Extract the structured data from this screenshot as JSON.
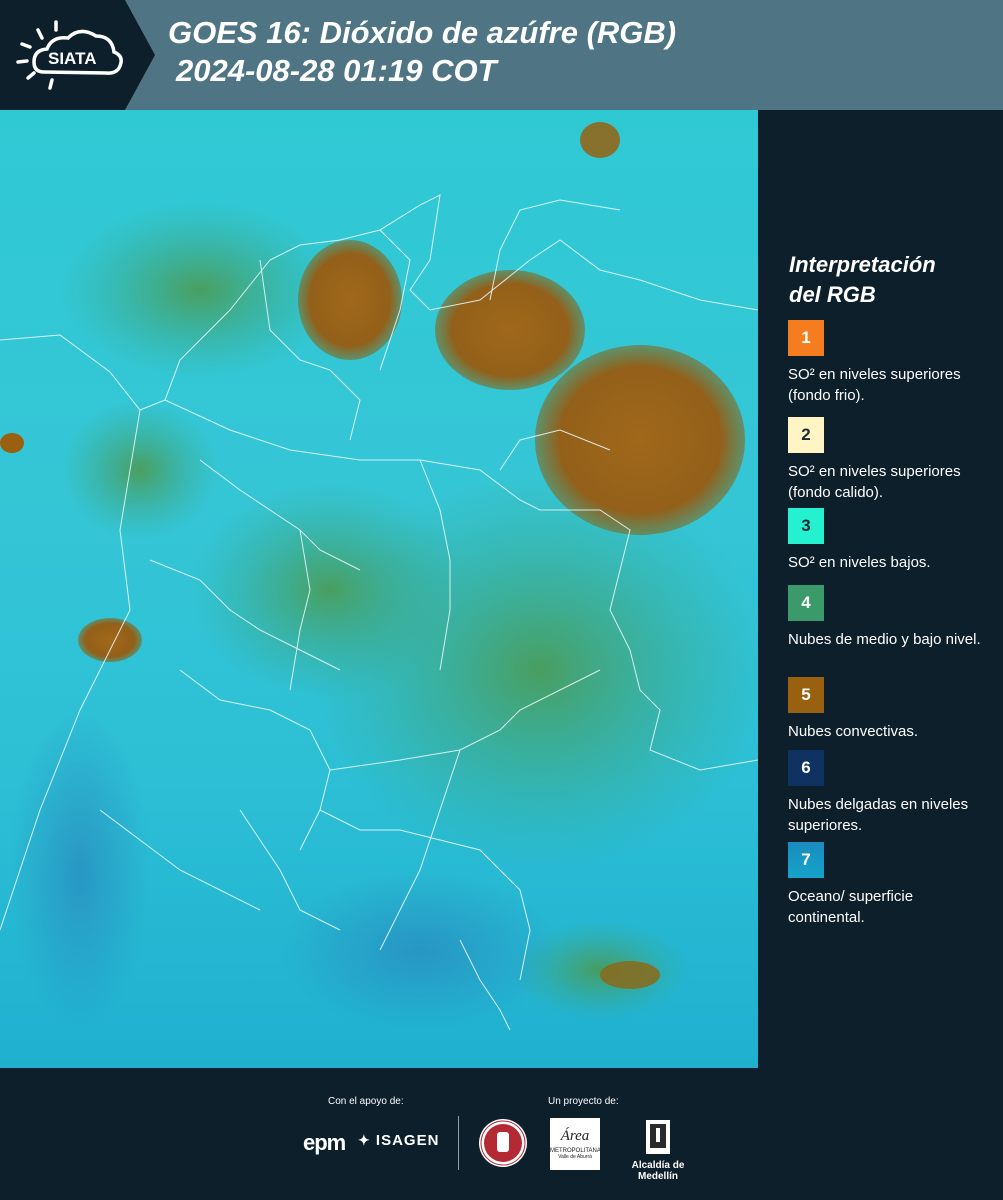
{
  "header": {
    "logo_text": "SIATA",
    "title_line1": "GOES 16: Dióxido de azúfre (RGB)",
    "title_line2": "2024-08-28 01:19 COT"
  },
  "legend": {
    "title_line1": "Interpretación",
    "title_line2": "del RGB",
    "items": [
      {
        "num": "1",
        "color": "#f57c1f",
        "label": "SO² en niveles superiores (fondo frio)."
      },
      {
        "num": "2",
        "color": "#fff5c4",
        "label": "SO² en niveles superiores (fondo calido)."
      },
      {
        "num": "3",
        "color": "#25f0cf",
        "label": "SO² en niveles bajos."
      },
      {
        "num": "4",
        "color": "#3a9a6a",
        "label": "Nubes de medio y bajo nivel."
      },
      {
        "num": "5",
        "color": "#98600f",
        "label": "Nubes convectivas."
      },
      {
        "num": "6",
        "color": "#0f3263",
        "label": "Nubes delgadas en niveles superiores."
      },
      {
        "num": "7",
        "color": "#1a8cc0",
        "label": "Oceano/ superficie continental."
      }
    ]
  },
  "footer": {
    "support_label": "Con el apoyo de:",
    "project_label": "Un proyecto de:",
    "epm_text": "epm",
    "isagen_text": "ISAGEN",
    "area_text": "Área",
    "area_sub": "METROPOLITANA",
    "area_sub2": "Valle de Aburrá",
    "alcaldia_text": "Alcaldía de Medellín"
  },
  "colors": {
    "header_bg": "#4f7585",
    "logo_bg": "#0d1f2b",
    "sidebar_bg": "#0d1f2b",
    "map_ocean": "#2fc9d4",
    "cloud_convective": "#98600f",
    "cloud_low": "#3a9a6a"
  }
}
